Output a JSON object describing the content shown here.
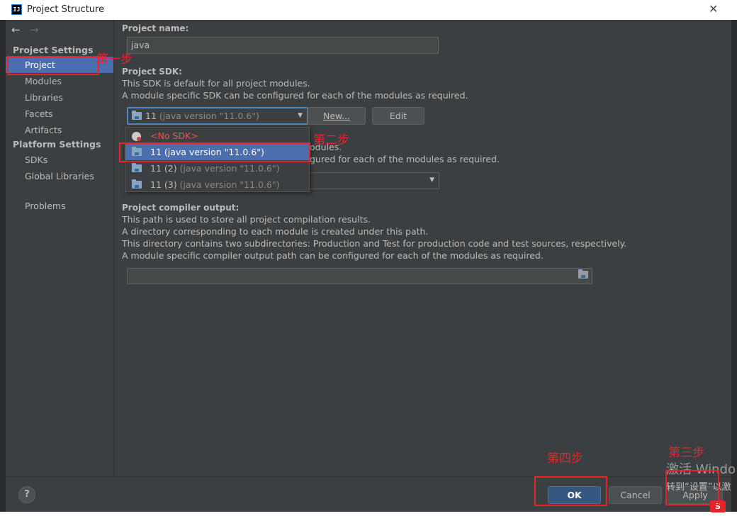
{
  "window": {
    "title": "Project Structure",
    "app_icon_text": "IJ",
    "close_glyph": "✕"
  },
  "nav": {
    "back": "←",
    "forward": "→"
  },
  "sidebar": {
    "project_settings_header": "Project Settings",
    "project_items": [
      "Project",
      "Modules",
      "Libraries",
      "Facets",
      "Artifacts"
    ],
    "platform_settings_header": "Platform Settings",
    "platform_items": [
      "SDKs",
      "Global Libraries"
    ],
    "problems": "Problems",
    "selected": "Project"
  },
  "content": {
    "project_name_label": "Project name:",
    "project_name_value": "java",
    "sdk_label": "Project SDK:",
    "sdk_desc_1": "This SDK is default for all project modules.",
    "sdk_desc_2": "A module specific SDK can be configured for each of the modules as required.",
    "sdk_selected": "11",
    "sdk_selected_version": "(java version \"11.0.6\")",
    "new_button": "New...",
    "edit_button": "Edit",
    "lang_desc_1_tail": "odules.",
    "lang_desc_2_tail": "gured for each of the modules as required.",
    "compiler_label": "Project compiler output:",
    "compiler_desc_1": "This path is used to store all project compilation results.",
    "compiler_desc_2": "A directory corresponding to each module is created under this path.",
    "compiler_desc_3": "This directory contains two subdirectories: Production and Test for production code and test sources, respectively.",
    "compiler_desc_4": "A module specific compiler output path can be configured for each of the modules as required.",
    "compiler_output_value": ""
  },
  "dropdown": {
    "no_sdk": "<No SDK>",
    "options": [
      {
        "name": "11",
        "version": "(java version \"11.0.6\")",
        "selected": true
      },
      {
        "name": "11 (2)",
        "version": "(java version \"11.0.6\")",
        "selected": false
      },
      {
        "name": "11 (3)",
        "version": "(java version \"11.0.6\")",
        "selected": false
      }
    ]
  },
  "buttons": {
    "help": "?",
    "ok": "OK",
    "cancel": "Cancel",
    "apply": "Apply"
  },
  "annotations": {
    "step1": "第一步",
    "step2": "第二步",
    "step3": "第三步",
    "step4": "第四步"
  },
  "overlay": {
    "watermark_line1": "激活 Windo",
    "watermark_line2": "转到“设置”以激",
    "ime_icon": "S"
  },
  "colors": {
    "background": "#3c3f41",
    "selection": "#4b6eaf",
    "ok_button": "#365880",
    "annotation_red": "#e8242a",
    "no_sdk_red": "#f05050"
  }
}
